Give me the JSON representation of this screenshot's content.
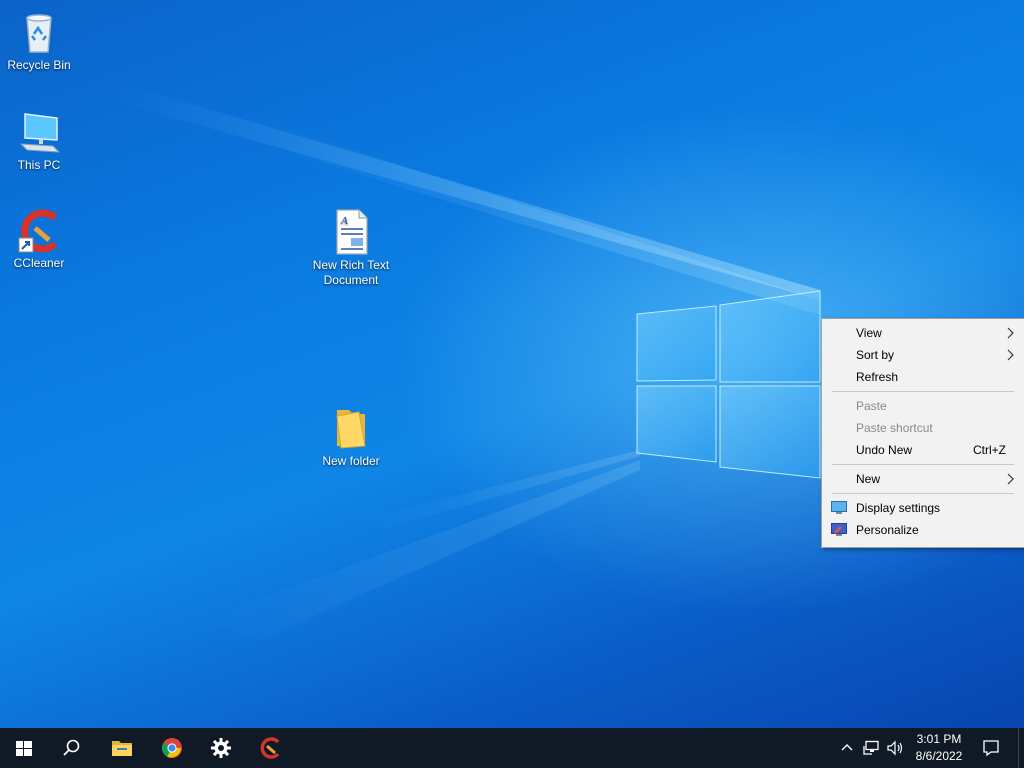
{
  "desktop": {
    "icons": [
      {
        "label": "Recycle Bin"
      },
      {
        "label": "This PC"
      },
      {
        "label": "CCleaner"
      },
      {
        "label": "New Rich Text Document"
      },
      {
        "label": "New folder"
      }
    ]
  },
  "context_menu": {
    "items": [
      {
        "label": "View",
        "submenu": true,
        "enabled": true
      },
      {
        "label": "Sort by",
        "submenu": true,
        "enabled": true
      },
      {
        "label": "Refresh",
        "enabled": true
      },
      {
        "label": "Paste",
        "enabled": false
      },
      {
        "label": "Paste shortcut",
        "enabled": false
      },
      {
        "label": "Undo New",
        "shortcut": "Ctrl+Z",
        "enabled": true
      },
      {
        "label": "New",
        "submenu": true,
        "enabled": true
      },
      {
        "label": "Display settings",
        "icon": "display-settings-icon",
        "enabled": true
      },
      {
        "label": "Personalize",
        "icon": "personalize-icon",
        "enabled": true
      }
    ]
  },
  "taskbar": {
    "pinned": [
      {
        "icon": "windows-start-icon"
      },
      {
        "icon": "search-icon"
      },
      {
        "icon": "file-explorer-icon"
      },
      {
        "icon": "chrome-icon"
      },
      {
        "icon": "settings-gear-icon"
      },
      {
        "icon": "ccleaner-icon"
      }
    ],
    "tray": {
      "time": "3:01 PM",
      "date": "8/6/2022",
      "icons": [
        "chevron-up-icon",
        "network-icon",
        "volume-icon",
        "notification-icon"
      ]
    }
  },
  "colors": {
    "taskbar_bg": "#101a26",
    "menu_bg": "#f2f2f2",
    "disabled_text": "#8a8a8a"
  }
}
